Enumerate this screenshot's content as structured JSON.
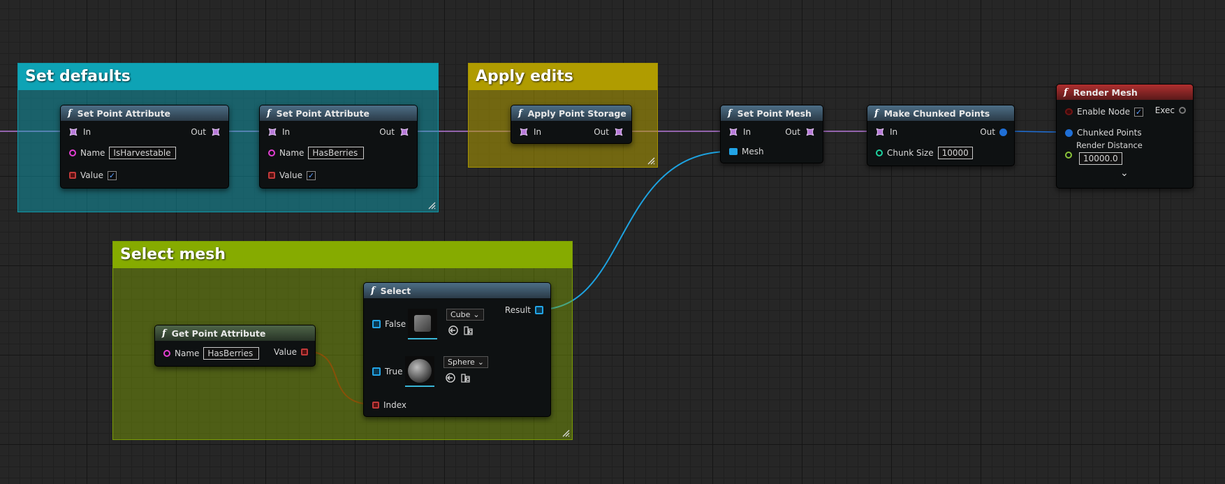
{
  "comments": {
    "set_defaults": {
      "title": "Set defaults",
      "color": "#0ea3b5"
    },
    "apply_edits": {
      "title": "Apply edits",
      "color": "#b09c00"
    },
    "select_mesh": {
      "title": "Select mesh",
      "color": "#86ab00"
    }
  },
  "nodes": {
    "set_point_attr_1": {
      "title": "Set Point Attribute",
      "in_label": "In",
      "out_label": "Out",
      "name_label": "Name",
      "name_value": "IsHarvestable",
      "value_label": "Value",
      "value_checked": true
    },
    "set_point_attr_2": {
      "title": "Set Point Attribute",
      "in_label": "In",
      "out_label": "Out",
      "name_label": "Name",
      "name_value": "HasBerries",
      "value_label": "Value",
      "value_checked": true
    },
    "apply_point_storage": {
      "title": "Apply Point Storage",
      "in_label": "In",
      "out_label": "Out"
    },
    "set_point_mesh": {
      "title": "Set Point Mesh",
      "in_label": "In",
      "out_label": "Out",
      "mesh_label": "Mesh"
    },
    "make_chunked_points": {
      "title": "Make Chunked Points",
      "in_label": "In",
      "out_label": "Out",
      "chunk_size_label": "Chunk Size",
      "chunk_size_value": "10000"
    },
    "render_mesh": {
      "title": "Render Mesh",
      "enable_node_label": "Enable Node",
      "enable_node_checked": true,
      "exec_label": "Exec",
      "chunked_points_label": "Chunked Points",
      "render_distance_label": "Render Distance",
      "render_distance_value": "10000.0"
    },
    "get_point_attr": {
      "title": "Get Point Attribute",
      "name_label": "Name",
      "name_value": "HasBerries",
      "value_label": "Value"
    },
    "select": {
      "title": "Select",
      "false_label": "False",
      "false_asset": "Cube",
      "true_label": "True",
      "true_asset": "Sphere",
      "result_label": "Result",
      "index_label": "Index"
    }
  },
  "icons": {
    "function": "f",
    "check": "✓",
    "chevron": "⌄"
  },
  "colors": {
    "exec_wire": "#b779d9",
    "mesh_wire": "#1da2e0",
    "bool_wire": "#8a0e0e",
    "points_wire": "#1f6fd6",
    "name_pin": "#e33fd3",
    "bool_pin": "#c23a3a",
    "mesh_pin": "#22a4e6",
    "float_pin": "#8ac43a",
    "int_pin": "#1ed3a0"
  }
}
